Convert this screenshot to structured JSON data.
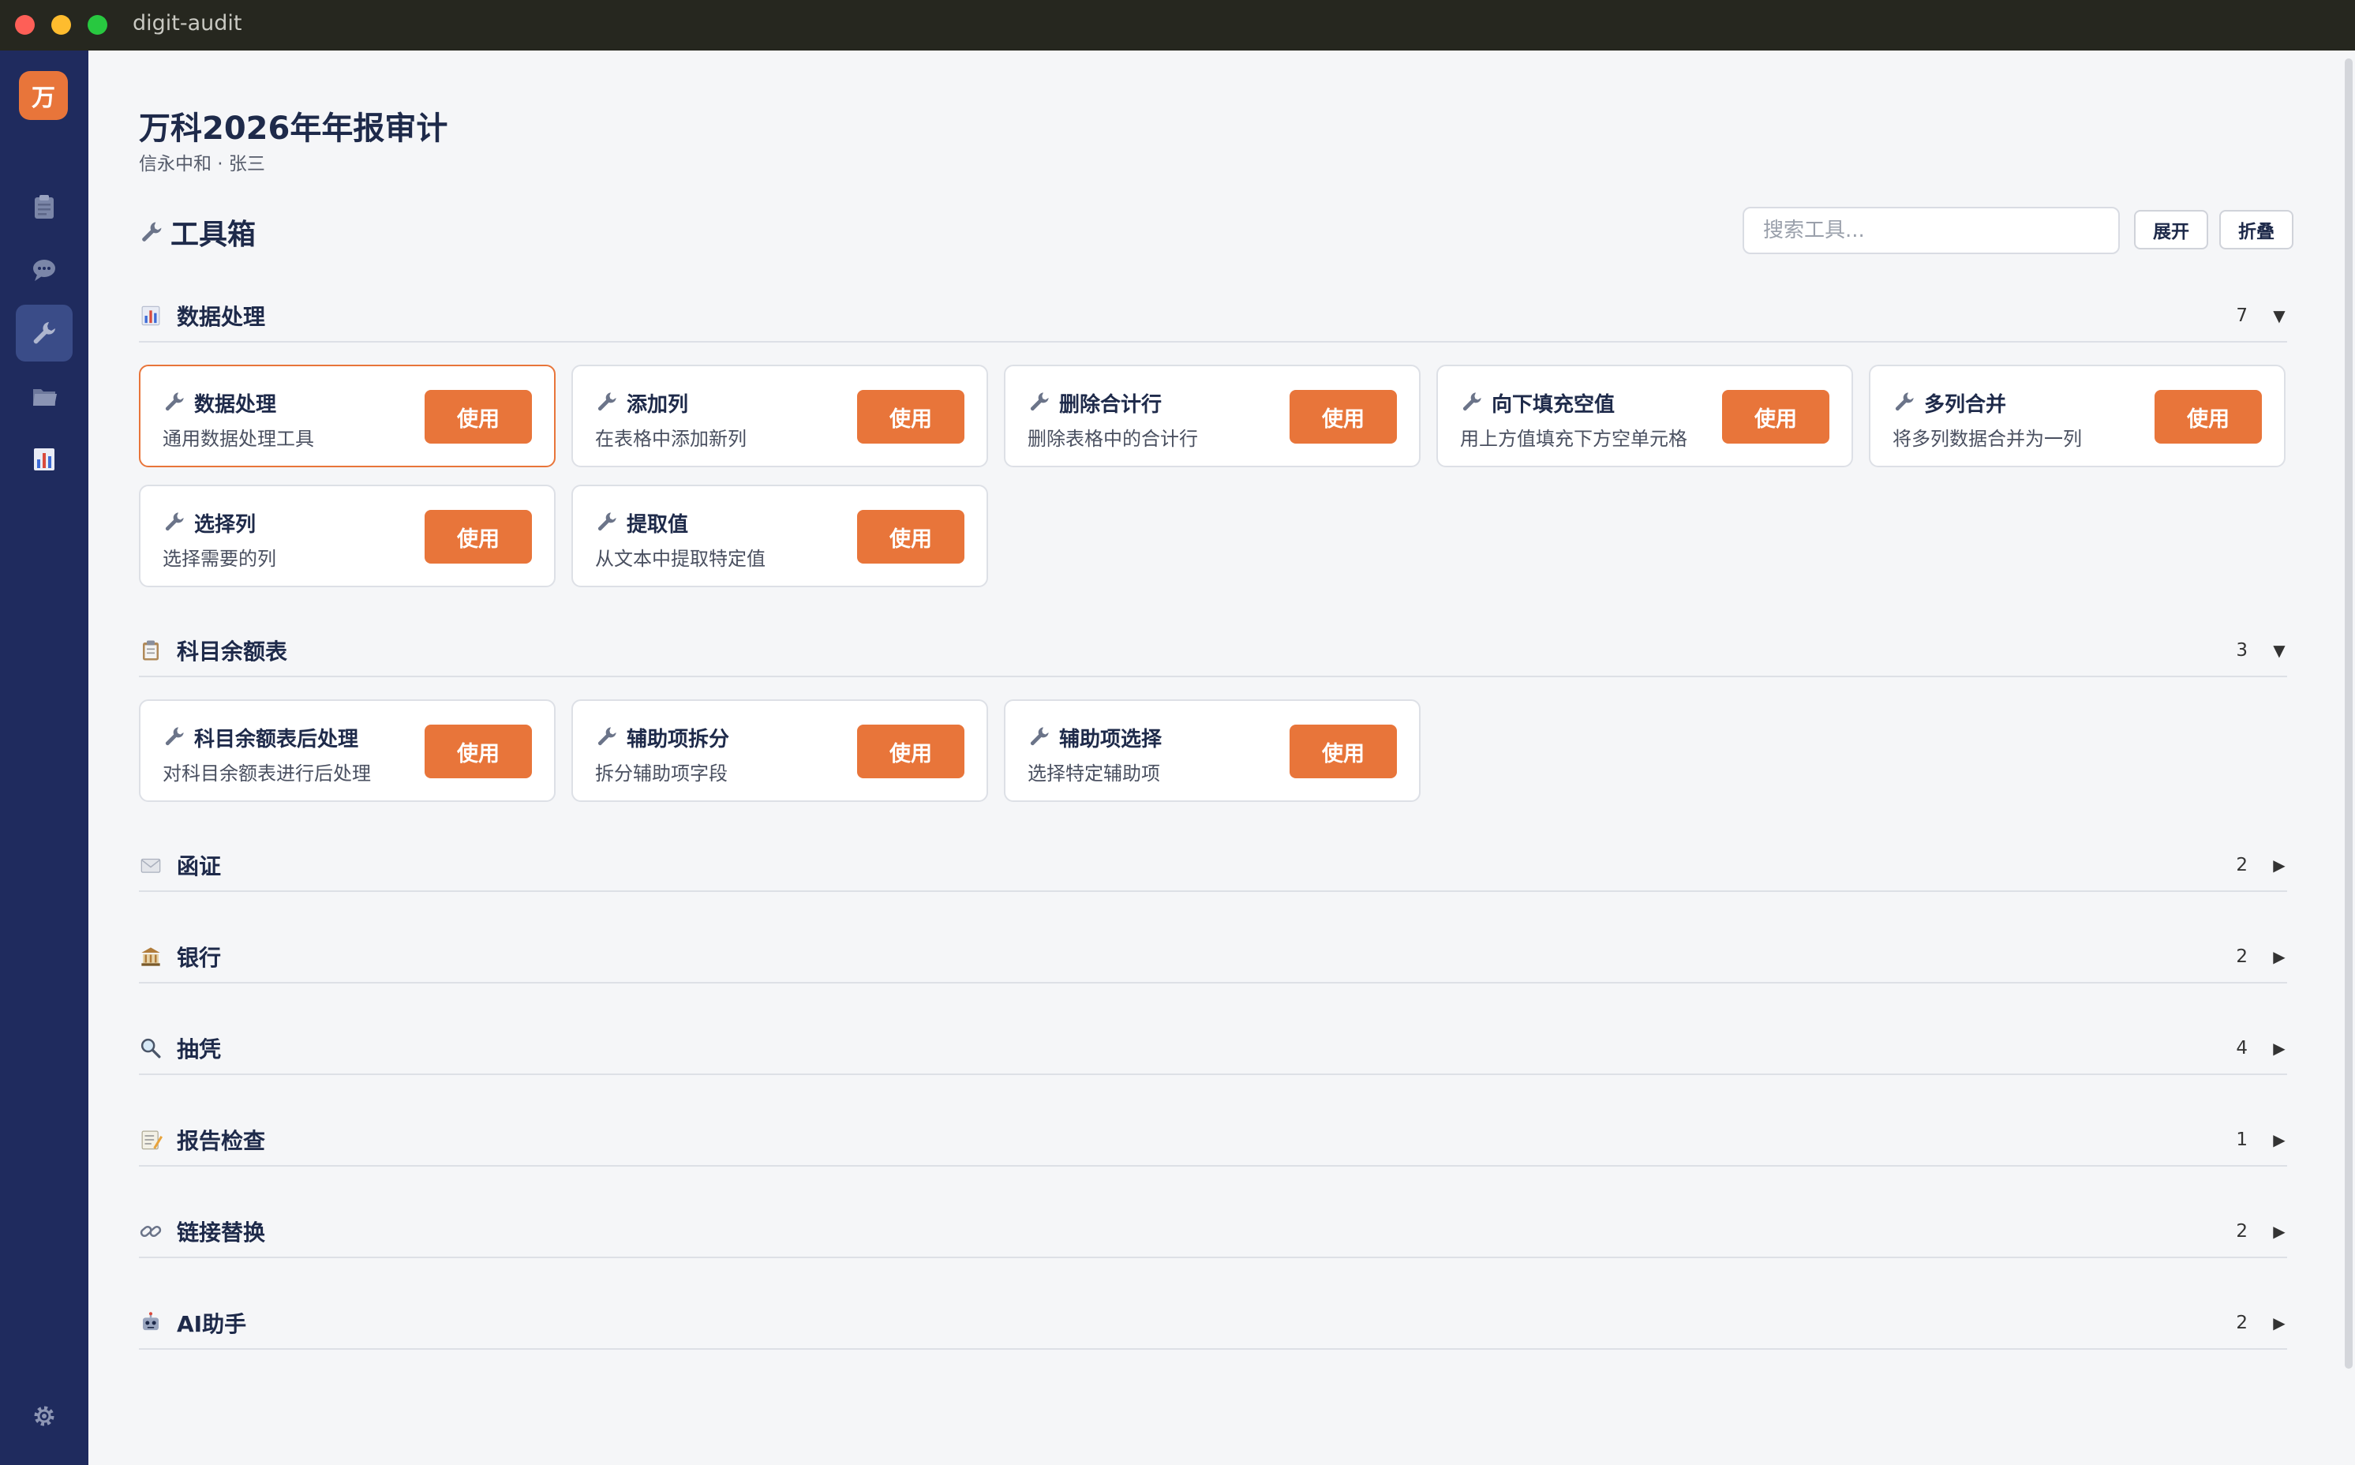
{
  "window": {
    "title": "digit-audit"
  },
  "sidebar": {
    "brand": "万",
    "items": [
      {
        "icon": "clipboard-icon",
        "active": false
      },
      {
        "icon": "chat-icon",
        "active": false
      },
      {
        "icon": "wrench-icon",
        "active": true
      },
      {
        "icon": "folder-icon",
        "active": false
      },
      {
        "icon": "bar-chart-icon",
        "active": false
      }
    ],
    "settings_icon": "gear-icon"
  },
  "header": {
    "title": "万科2026年年报审计",
    "subtitle": "信永中和 · 张三"
  },
  "toolbox": {
    "title": "工具箱",
    "search_placeholder": "搜索工具...",
    "expand_label": "展开",
    "collapse_label": "折叠"
  },
  "use_label": "使用",
  "sections": [
    {
      "title": "数据处理",
      "icon": "bar-chart-icon",
      "count": "7",
      "expanded": true,
      "tools": [
        {
          "name": "数据处理",
          "desc": "通用数据处理工具"
        },
        {
          "name": "添加列",
          "desc": "在表格中添加新列"
        },
        {
          "name": "删除合计行",
          "desc": "删除表格中的合计行"
        },
        {
          "name": "向下填充空值",
          "desc": "用上方值填充下方空单元格"
        },
        {
          "name": "多列合并",
          "desc": "将多列数据合并为一列"
        },
        {
          "name": "选择列",
          "desc": "选择需要的列"
        },
        {
          "name": "提取值",
          "desc": "从文本中提取特定值"
        }
      ]
    },
    {
      "title": "科目余额表",
      "icon": "clipboard-icon",
      "count": "3",
      "expanded": true,
      "tools": [
        {
          "name": "科目余额表后处理",
          "desc": "对科目余额表进行后处理"
        },
        {
          "name": "辅助项拆分",
          "desc": "拆分辅助项字段"
        },
        {
          "name": "辅助项选择",
          "desc": "选择特定辅助项"
        }
      ]
    },
    {
      "title": "函证",
      "icon": "envelope-icon",
      "count": "2",
      "expanded": false
    },
    {
      "title": "银行",
      "icon": "bank-icon",
      "count": "2",
      "expanded": false
    },
    {
      "title": "抽凭",
      "icon": "magnifier-icon",
      "count": "4",
      "expanded": false
    },
    {
      "title": "报告检查",
      "icon": "memo-icon",
      "count": "1",
      "expanded": false
    },
    {
      "title": "链接替换",
      "icon": "link-icon",
      "count": "2",
      "expanded": false
    },
    {
      "title": "AI助手",
      "icon": "robot-icon",
      "count": "2",
      "expanded": false
    }
  ],
  "colors": {
    "accent": "#e8753a",
    "sidebar": "#1f2b5e",
    "title": "#1e2a4a"
  }
}
